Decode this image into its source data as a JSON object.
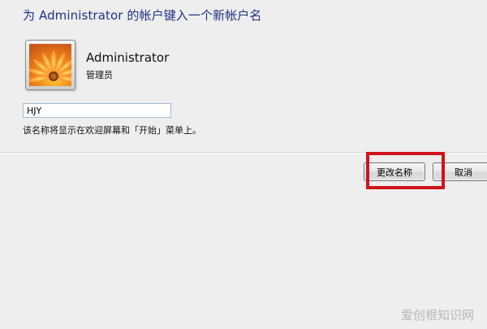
{
  "dialog": {
    "heading": "为 Administrator 的帐户键入一个新帐户名"
  },
  "account": {
    "picture_icon": "flower-avatar-icon",
    "name": "Administrator",
    "role": "管理员"
  },
  "rename": {
    "input_value": "HJY",
    "hint": "该名称将显示在欢迎屏幕和「开始」菜单上。"
  },
  "buttons": {
    "rename_label": "更改名称",
    "cancel_label": "取消"
  },
  "annotation": {
    "highlight_color": "#d0121b"
  },
  "watermark": {
    "text": "爱创根知识网"
  }
}
